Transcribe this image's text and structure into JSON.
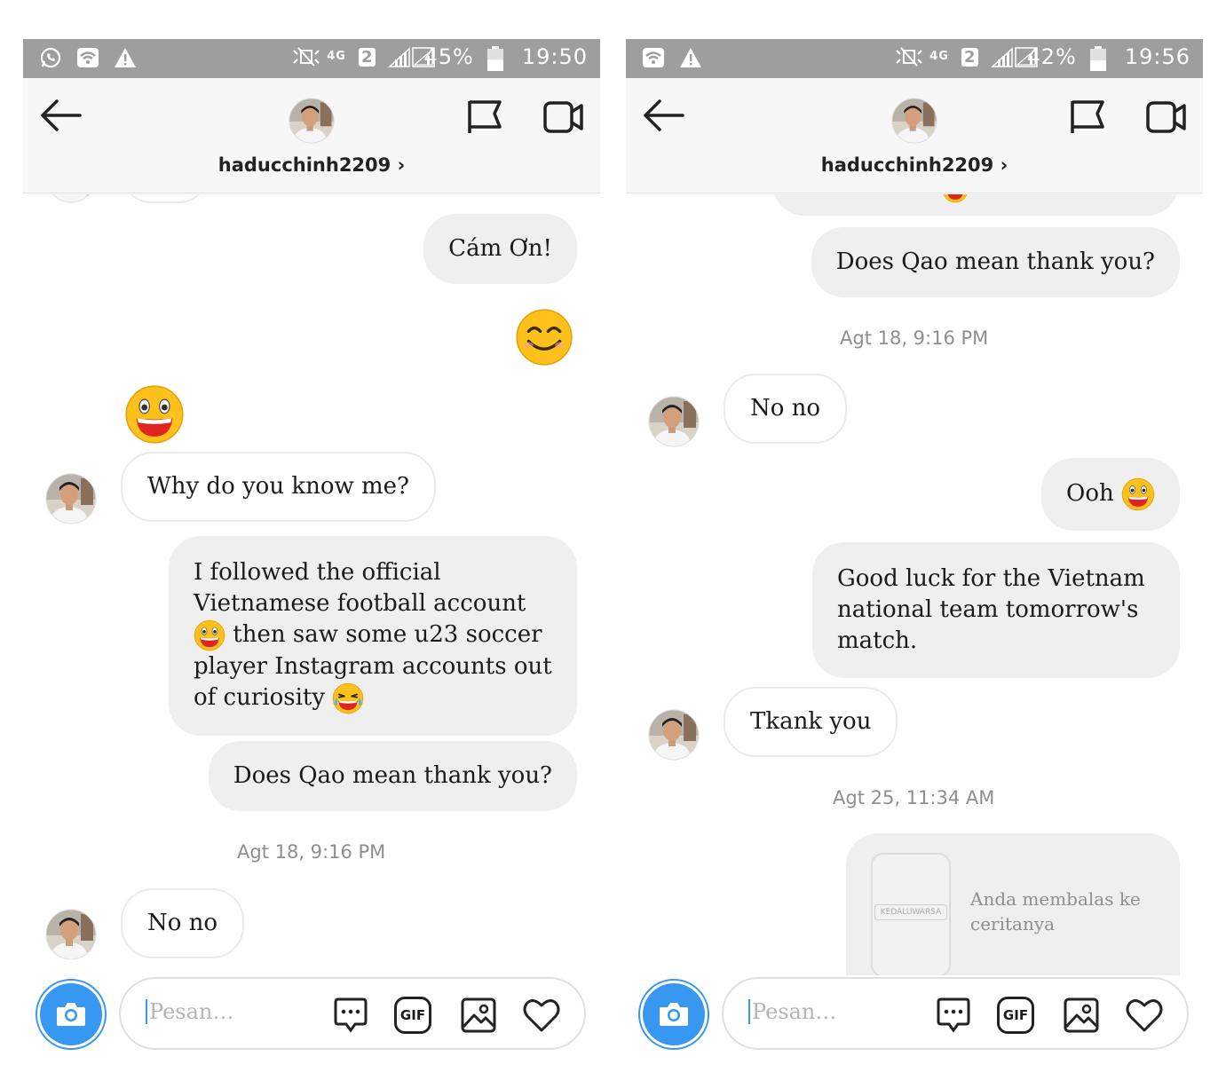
{
  "left": {
    "status": {
      "percent": "45%",
      "time": "19:50",
      "net": "4G",
      "sim": "2"
    },
    "header": {
      "username": "haducchinh2209 ›"
    },
    "messages": {
      "cam_on": "Cám Ơn!",
      "why": "Why do you know me?",
      "followed_1": "I followed the official",
      "followed_2": "Vietnamese football account",
      "followed_3": "then saw some u23 soccer",
      "followed_4": "player Instagram accounts out",
      "followed_5": "of curiosity",
      "qao": "Does Qao mean thank you?",
      "timestamp": "Agt 18, 9:16 PM",
      "nono": "No no"
    },
    "input": {
      "placeholder": "Pesan…",
      "gif": "GIF"
    }
  },
  "right": {
    "status": {
      "percent": "42%",
      "time": "19:56",
      "net": "4G",
      "sim": "2"
    },
    "header": {
      "username": "haducchinh2209 ›"
    },
    "messages": {
      "qao": "Does Qao mean thank you?",
      "timestamp1": "Agt 18, 9:16 PM",
      "nono": "No no",
      "ooh": "Ooh",
      "goodluck_1": "Good luck for the Vietnam",
      "goodluck_2": "national team tomorrow's",
      "goodluck_3": "match.",
      "tkank": "Tkank you",
      "timestamp2": "Agt 25, 11:34 AM",
      "story_label": "KEDALUWARSA",
      "reply_1": "Anda membalas ke",
      "reply_2": "ceritanya"
    },
    "input": {
      "placeholder": "Pesan…",
      "gif": "GIF"
    }
  },
  "colors": {
    "accent": "#3897f0",
    "status_bar": "#9e9e9e",
    "bubble_out": "#efefef",
    "emoji_yellow": "#fcc21b"
  },
  "icons": [
    "back-arrow-icon",
    "flag-icon",
    "video-icon",
    "camera-icon",
    "chat-bubble-icon",
    "gif-icon",
    "image-icon",
    "heart-icon",
    "whatsapp-icon",
    "wifi-icon",
    "warning-icon",
    "mute-icon",
    "signal-icon",
    "battery-icon"
  ]
}
